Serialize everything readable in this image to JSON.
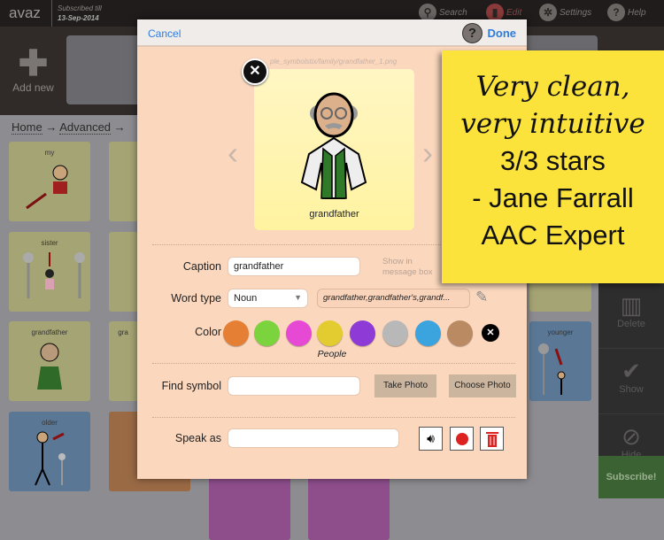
{
  "topbar": {
    "logo": "avaz",
    "subscribed_label": "Subscribed till",
    "subscribed_date": "13-Sep-2014",
    "search": "Search",
    "edit": "Edit",
    "settings": "Settings",
    "help": "Help"
  },
  "toolbar": {
    "add_new": "Add new"
  },
  "breadcrumb": {
    "home": "Home",
    "sep": "→",
    "advanced": "Advanced"
  },
  "tiles": {
    "my": "my",
    "sister": "sister",
    "grandfather": "grandfather",
    "gra": "gra",
    "older": "older",
    "younger": "younger"
  },
  "right_panel": {
    "delete": "Delete",
    "show": "Show",
    "hide": "Hide",
    "subscribe": "Subscribe!"
  },
  "modal": {
    "cancel": "Cancel",
    "help": "?",
    "done": "Done",
    "filename": "ple_symbolstix/family/grandfather_1.png",
    "image_caption": "grandfather",
    "caption_label": "Caption",
    "caption_value": "grandfather",
    "show_in_message_box": "Show in message box",
    "word_type_label": "Word type",
    "word_type_value": "Noun",
    "word_forms": "grandfather,grandfather's,grandf...",
    "color_label": "Color",
    "colors": [
      "#e57f33",
      "#7bd33d",
      "#e649d4",
      "#e3cc2f",
      "#8d3ad6",
      "#b8b8b8",
      "#3ba3de",
      "#ba8a63"
    ],
    "selected_color_name": "People",
    "find_symbol_label": "Find symbol",
    "find_symbol_value": "",
    "take_photo": "Take Photo",
    "choose_photo": "Choose Photo",
    "speak_as_label": "Speak as",
    "speak_as_value": ""
  },
  "review": {
    "line1": "Very clean,",
    "line2": "very intuitive",
    "line3": "3/3 stars",
    "line4": "- Jane Farrall",
    "line5": "AAC Expert"
  }
}
